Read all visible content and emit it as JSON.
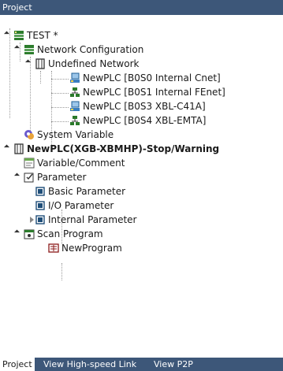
{
  "panel": {
    "title": "Project"
  },
  "tree": {
    "root": "TEST *",
    "network_config": "Network Configuration",
    "undefined_network": "Undefined Network",
    "net_items": [
      "NewPLC [B0S0 Internal Cnet]",
      "NewPLC [B0S1 Internal FEnet]",
      "NewPLC [B0S3 XBL-C41A]",
      "NewPLC [B0S4 XBL-EMTA]"
    ],
    "system_variable": "System Variable",
    "plc": "NewPLC(XGB-XBMHP)-Stop/Warning",
    "variable_comment": "Variable/Comment",
    "parameter": "Parameter",
    "param_items": [
      "Basic Parameter",
      "I/O Parameter",
      "Internal Parameter"
    ],
    "scan_program": "Scan Program",
    "program": "NewProgram"
  },
  "tabs": [
    "Project",
    "View High-speed Link",
    "View P2P"
  ]
}
